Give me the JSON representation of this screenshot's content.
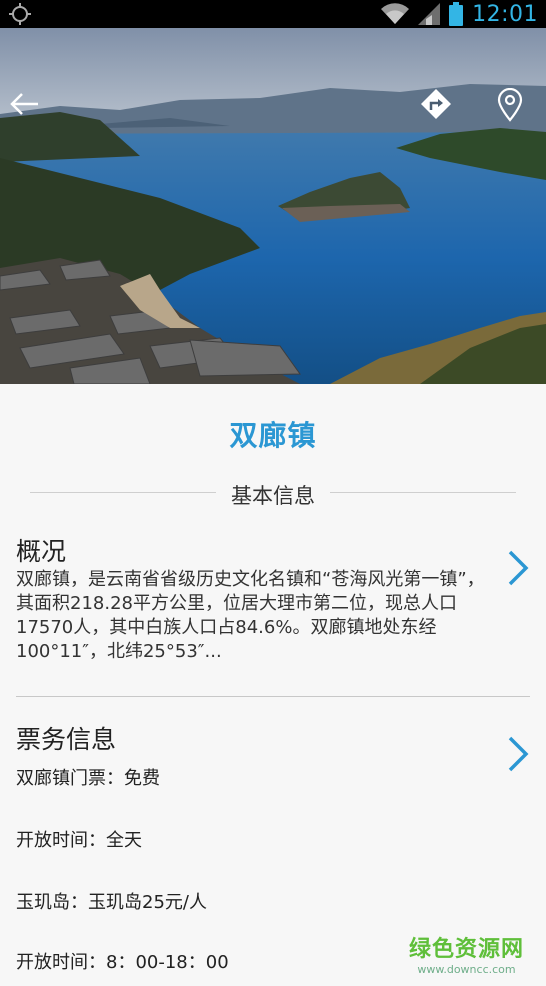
{
  "status_bar": {
    "time": "12:01"
  },
  "hero": {
    "actions": [
      "back-arrow-icon",
      "directions-icon",
      "location-pin-icon"
    ]
  },
  "place": {
    "title": "双廊镇"
  },
  "section": {
    "label": "基本信息"
  },
  "overview": {
    "title": "概况",
    "text": "双廊镇，是云南省省级历史文化名镇和“苍海风光第一镇”，其面积218.28平方公里，位居大理市第二位，现总人口17570人，其中白族人口占84.6%。双廊镇地处东经100°11″，北纬25°53″..."
  },
  "tickets": {
    "title": "票务信息",
    "lines": [
      "双廊镇门票：免费",
      "开放时间：全天",
      "玉玑岛：玉玑岛25元/人",
      "开放时间：8：00-18：00"
    ]
  },
  "watermark": {
    "main": "绿色资源网",
    "sub": "www.downcc.com"
  },
  "colors": {
    "accent": "#2b97d3",
    "status_accent": "#33b5e5"
  }
}
